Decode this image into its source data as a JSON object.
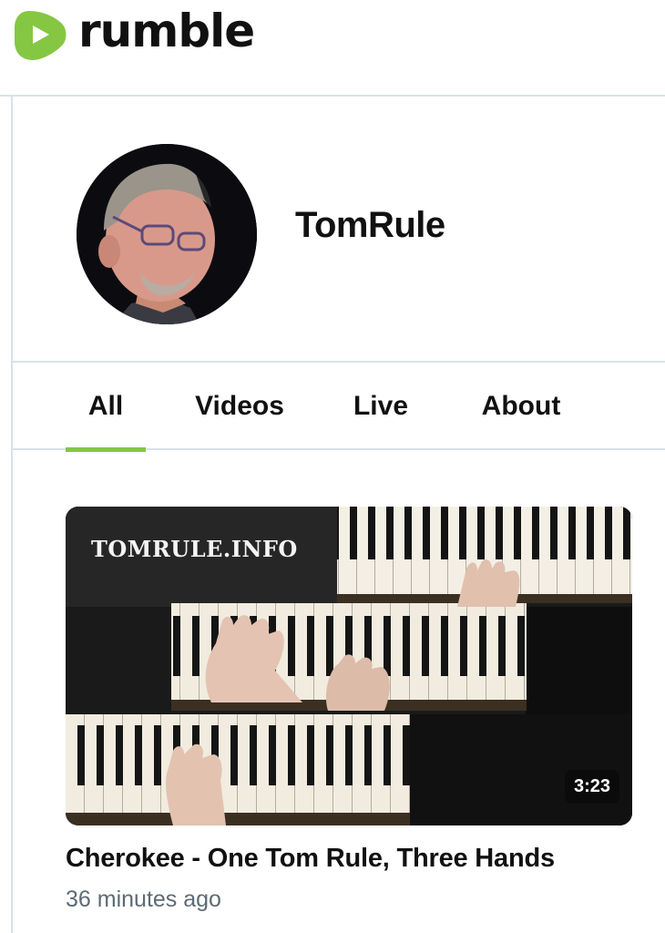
{
  "brand": {
    "name": "rumble",
    "accent_color": "#85c742"
  },
  "channel": {
    "name": "TomRule",
    "avatar_icon": "channel-avatar-photo"
  },
  "tabs": [
    {
      "label": "All",
      "active": true
    },
    {
      "label": "Videos",
      "active": false
    },
    {
      "label": "Live",
      "active": false
    },
    {
      "label": "About",
      "active": false
    }
  ],
  "videos": [
    {
      "title": "Cherokee - One Tom Rule, Three Hands",
      "posted": "36 minutes ago",
      "duration": "3:23",
      "thumbnail_watermark": "TOMRULE.INFO"
    }
  ]
}
